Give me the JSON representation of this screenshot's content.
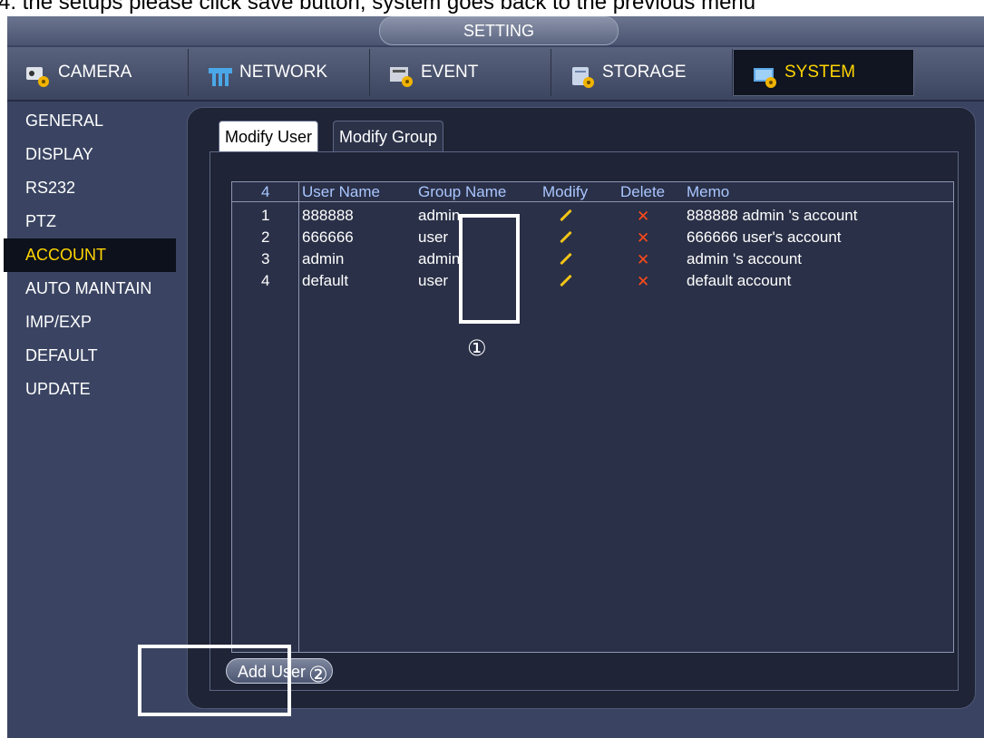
{
  "caption": "4. the setups please click save button, system goes back to the previous menu",
  "window": {
    "title": "SETTING"
  },
  "main_tabs": [
    {
      "label": "CAMERA"
    },
    {
      "label": "NETWORK"
    },
    {
      "label": "EVENT"
    },
    {
      "label": "STORAGE"
    },
    {
      "label": "SYSTEM"
    }
  ],
  "active_main_tab": "SYSTEM",
  "sidebar": {
    "items": [
      {
        "label": "GENERAL"
      },
      {
        "label": "DISPLAY"
      },
      {
        "label": "RS232"
      },
      {
        "label": "PTZ"
      },
      {
        "label": "ACCOUNT"
      },
      {
        "label": "AUTO MAINTAIN"
      },
      {
        "label": "IMP/EXP"
      },
      {
        "label": "DEFAULT"
      },
      {
        "label": "UPDATE"
      }
    ],
    "active": "ACCOUNT"
  },
  "sub_tabs": [
    {
      "label": "Modify User"
    },
    {
      "label": "Modify Group"
    }
  ],
  "table": {
    "count": "4",
    "headers": [
      "User Name",
      "Group Name",
      "Modify",
      "Delete",
      "Memo"
    ],
    "rows": [
      {
        "index": "1",
        "user": "888888",
        "group": "admin",
        "memo": "888888 admin 's account"
      },
      {
        "index": "2",
        "user": "666666",
        "group": "user",
        "memo": "666666 user's account"
      },
      {
        "index": "3",
        "user": "admin",
        "group": "admin",
        "memo": "admin 's account"
      },
      {
        "index": "4",
        "user": "default",
        "group": "user",
        "memo": "default account"
      }
    ]
  },
  "add_user_label": "Add User",
  "callouts": [
    "①",
    "②"
  ],
  "colors": {
    "active_accent": "#ffd500",
    "header_text": "#a9c6ff",
    "delete_icon": "#ff4a1a",
    "modify_icon": "#f3c417"
  },
  "icons": {
    "camera": "camera-gear-icon",
    "network": "network-icon",
    "event": "event-gear-icon",
    "storage": "storage-gear-icon",
    "system": "system-gear-icon",
    "modify": "pencil-icon",
    "delete": "close-x-icon"
  }
}
